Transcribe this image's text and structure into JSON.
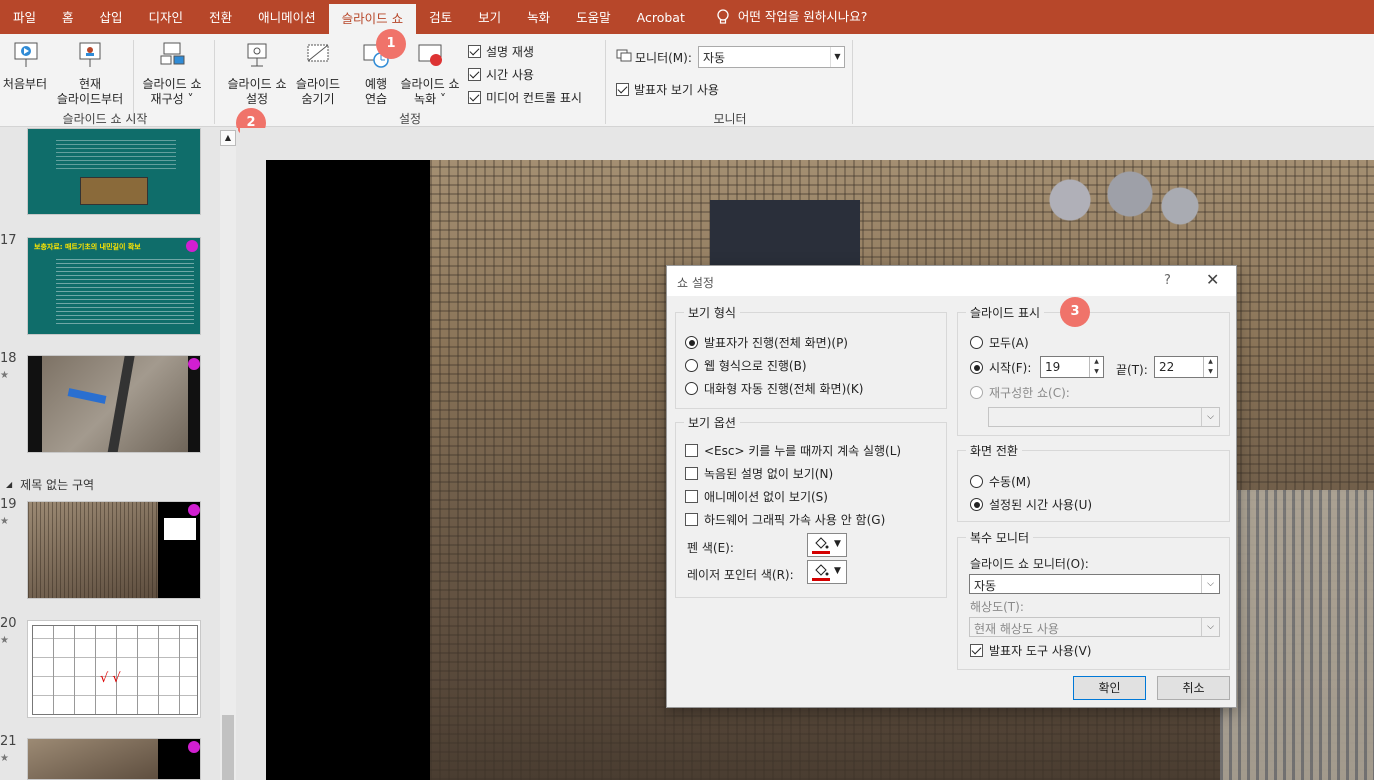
{
  "ribbon_tabs": [
    "파일",
    "홈",
    "삽입",
    "디자인",
    "전환",
    "애니메이션",
    "슬라이드 쇼",
    "검토",
    "보기",
    "녹화",
    "도움말",
    "Acrobat"
  ],
  "tell_me": "어떤 작업을 원하시나요?",
  "ribbon": {
    "start_group": {
      "from_beginning": "처음부터",
      "from_current_1": "현재",
      "from_current_2": "슬라이드부터",
      "custom_1": "슬라이드 쇼",
      "custom_2": "재구성 ˅",
      "label": "슬라이드 쇼 시작"
    },
    "setup_group": {
      "setup_1": "슬라이드 쇼",
      "setup_2": "설정",
      "hide_1": "슬라이드",
      "hide_2": "숨기기",
      "rehearse_1": "예행",
      "rehearse_2": "연습",
      "record_1": "슬라이드 쇼",
      "record_2": "녹화 ˅",
      "play_narration": "설명 재생",
      "use_timings": "시간 사용",
      "show_media_controls": "미디어 컨트롤 표시",
      "label": "설정"
    },
    "monitor_group": {
      "monitor_label": "모니터(M):",
      "monitor_value": "자동",
      "presenter_view": "발표자 보기 사용",
      "label": "모니터"
    }
  },
  "badges": [
    "1",
    "2",
    "3"
  ],
  "thumbnails": {
    "numbers": [
      "17",
      "18",
      "19",
      "20",
      "21"
    ],
    "star": "★",
    "section": "제목 없는 구역",
    "slide17_title": "보충자료: 매트기초의 내민길이 확보"
  },
  "dialog": {
    "title": "쇼 설정",
    "help": "?",
    "close": "✕",
    "show_type": {
      "legend": "보기 형식",
      "options": [
        "발표자가 진행(전체 화면)(P)",
        "웹 형식으로 진행(B)",
        "대화형 자동 진행(전체 화면)(K)"
      ]
    },
    "show_options": {
      "legend": "보기 옵션",
      "options": [
        "<Esc> 키를 누를 때까지 계속 실행(L)",
        "녹음된 설명 없이 보기(N)",
        "애니메이션 없이 보기(S)",
        "하드웨어 그래픽 가속 사용 안 함(G)"
      ],
      "pen_color": "펜 색(E):",
      "laser_color": "레이저 포인터 색(R):"
    },
    "show_slides": {
      "legend": "슬라이드 표시",
      "all": "모두(A)",
      "from": "시작(F):",
      "from_value": "19",
      "to": "끝(T):",
      "to_value": "22",
      "custom": "재구성한 쇼(C):"
    },
    "advance": {
      "legend": "화면 전환",
      "manual": "수동(M)",
      "timings": "설정된 시간 사용(U)"
    },
    "multi_monitor": {
      "legend": "복수 모니터",
      "monitor_label": "슬라이드 쇼 모니터(O):",
      "monitor_value": "자동",
      "resolution_label": "해상도(T):",
      "resolution_value": "현재 해상도 사용",
      "presenter_tools": "발표자 도구 사용(V)"
    },
    "ok": "확인",
    "cancel": "취소"
  },
  "colors": {
    "accent": "#b7472a",
    "badge": "#f0736a",
    "thumb_teal": "#0f6d6a"
  }
}
